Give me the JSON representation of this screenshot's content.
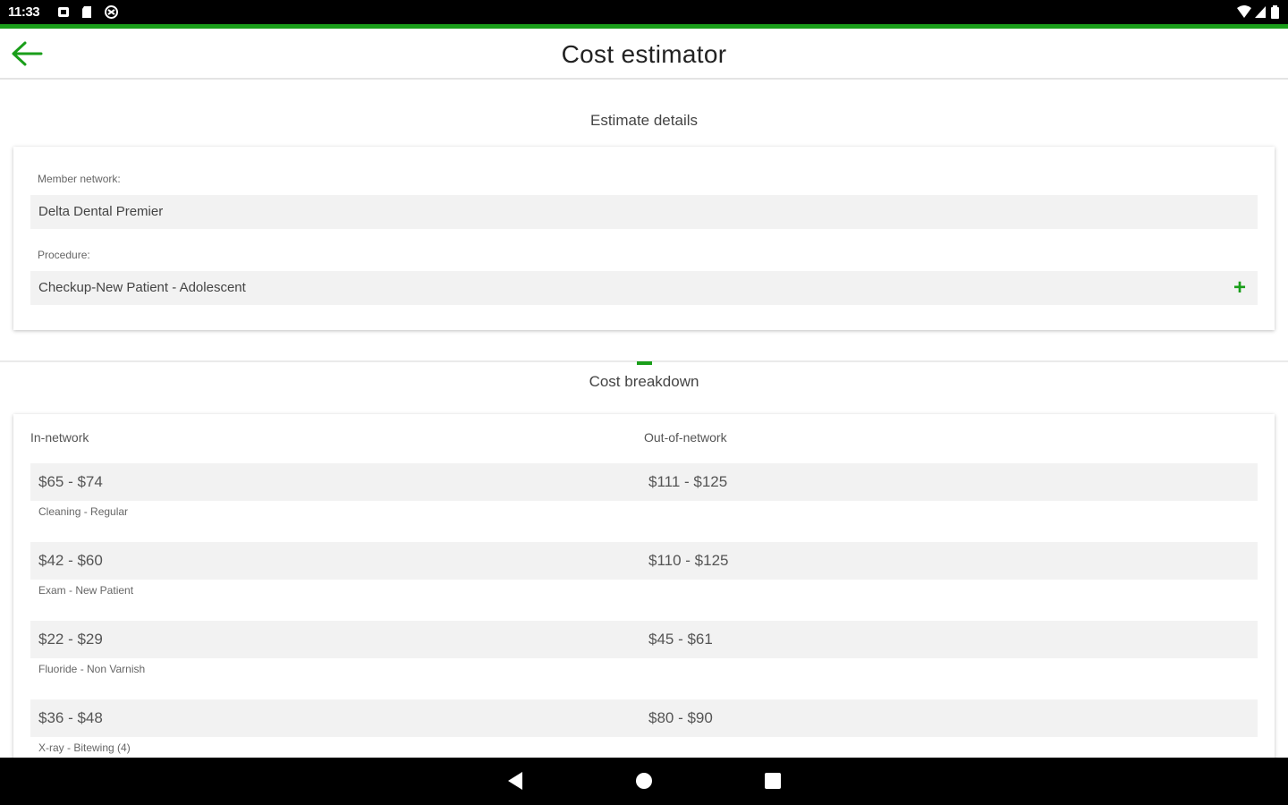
{
  "status_bar": {
    "time": "11:33"
  },
  "app_bar": {
    "title": "Cost estimator"
  },
  "estimate": {
    "section_title": "Estimate details",
    "network_label": "Member network:",
    "network_value": "Delta Dental Premier",
    "procedure_label": "Procedure:",
    "procedure_value": "Checkup-New Patient - Adolescent"
  },
  "breakdown": {
    "section_title": "Cost breakdown",
    "in_network_header": "In-network",
    "out_network_header": "Out-of-network",
    "rows": [
      {
        "in": "$65 - $74",
        "out": "$111 - $125",
        "desc": "Cleaning - Regular"
      },
      {
        "in": "$42 - $60",
        "out": "$110 - $125",
        "desc": "Exam - New Patient"
      },
      {
        "in": "$22 - $29",
        "out": "$45 - $61",
        "desc": "Fluoride - Non Varnish"
      },
      {
        "in": "$36 - $48",
        "out": "$80 - $90",
        "desc": "X-ray - Bitewing (4)"
      }
    ]
  },
  "colors": {
    "accent": "#1a9e1a"
  },
  "icons": {
    "back": "arrow-left-icon",
    "add": "plus-icon",
    "nav_back": "triangle-back-icon",
    "nav_home": "circle-home-icon",
    "nav_recents": "square-recents-icon"
  }
}
